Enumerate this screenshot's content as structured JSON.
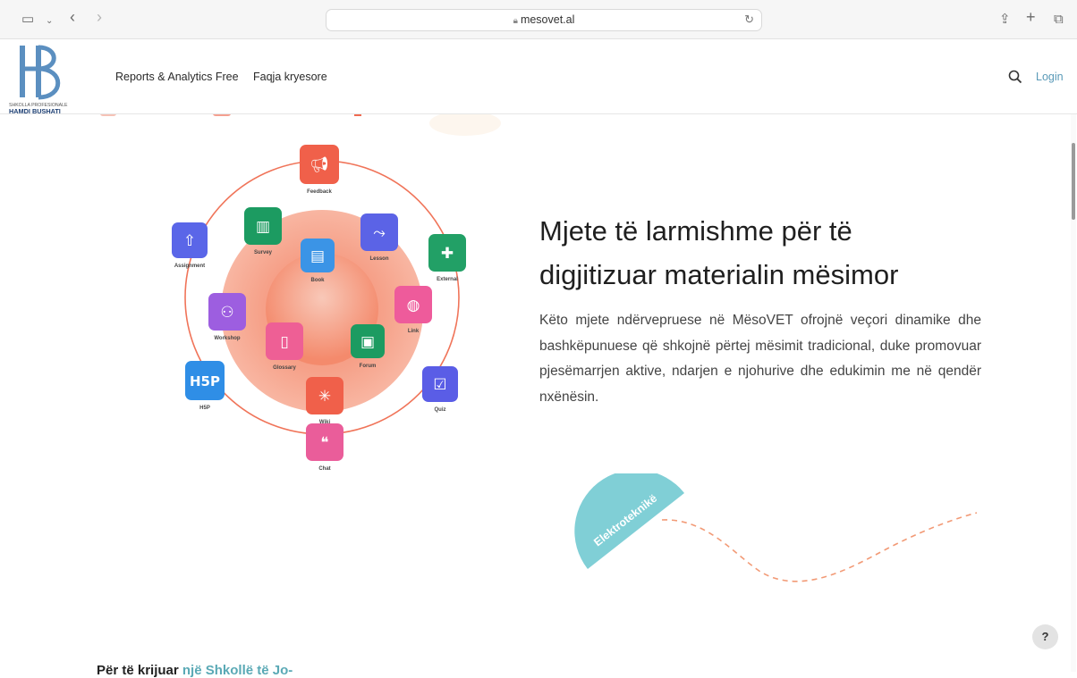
{
  "browser": {
    "url": "mesovet.al"
  },
  "site": {
    "logo_line1": "SHKOLLA PROFESIONALE",
    "logo_line2": "HAMDI BUSHATI",
    "nav": [
      "Reports & Analytics Free",
      "Faqja kryesore"
    ],
    "login_label": "Login"
  },
  "hero": {
    "heading_line1": "Mjete të larmishme për të",
    "heading_line2": "digjitizuar materialin mësimor",
    "paragraph": "Këto mjete ndërvepruese në MësoVET ofrojnë veçori dinamike dhe bashkëpunuese që shkojnë përtej mësimit tradicional, duke promovuar pjesëmarrjen aktive, ndarjen e njohurive dhe edukimin me në qendër nxënësin."
  },
  "diagram": {
    "tools": [
      {
        "label": "Feedback",
        "color": "#f0604a",
        "icon": "megaphone-icon"
      },
      {
        "label": "Survey",
        "color": "#1c9b61",
        "icon": "bar-chart-icon"
      },
      {
        "label": "Lesson",
        "color": "#5b63e6",
        "icon": "route-icon"
      },
      {
        "label": "External",
        "color": "#22a066",
        "icon": "puzzle-icon"
      },
      {
        "label": "Assignment",
        "color": "#5a66e8",
        "icon": "upload-file-icon"
      },
      {
        "label": "Book",
        "color": "#3b94e6",
        "icon": "book-icon"
      },
      {
        "label": "Link",
        "color": "#ee5b9b",
        "icon": "globe-icon"
      },
      {
        "label": "Workshop",
        "color": "#9d5ee0",
        "icon": "people-icon"
      },
      {
        "label": "Glossary",
        "color": "#ee5f95",
        "icon": "glossary-icon"
      },
      {
        "label": "Forum",
        "color": "#1c9b61",
        "icon": "forum-icon"
      },
      {
        "label": "H5P",
        "color": "#2f8ee6",
        "icon": "h5p-icon"
      },
      {
        "label": "Quiz",
        "color": "#5a5de6",
        "icon": "checkbox-icon"
      },
      {
        "label": "Wiki",
        "color": "#f0604a",
        "icon": "network-icon"
      },
      {
        "label": "Chat",
        "color": "#ea5d9a",
        "icon": "chat-icon"
      }
    ],
    "h5p_text": "H5P"
  },
  "badge": {
    "label": "Elektroteknikë",
    "color": "#80cfd6"
  },
  "bottom": {
    "text_dark": "Për të krijuar ",
    "text_accent": "një Shkollë të Jo-"
  },
  "help_label": "?"
}
